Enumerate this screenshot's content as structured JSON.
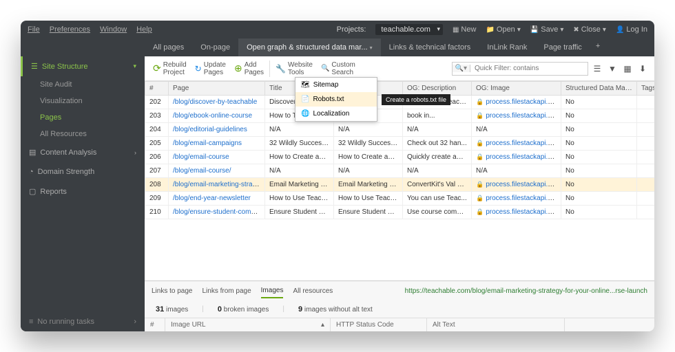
{
  "menubar": {
    "items": [
      "File",
      "Preferences",
      "Window",
      "Help"
    ],
    "projects_label": "Projects:",
    "project": "teachable.com",
    "actions": [
      "New",
      "Open",
      "Save",
      "Close",
      "Log In"
    ]
  },
  "tabs": [
    "All pages",
    "On-page",
    "Open graph & structured data mar...",
    "Links & technical factors",
    "InLink Rank",
    "Page traffic"
  ],
  "active_tab": 2,
  "sidebar": {
    "top": "Site Structure",
    "subs": [
      "Site Audit",
      "Visualization",
      "Pages",
      "All Resources"
    ],
    "active_sub": 2,
    "sections": [
      "Content Analysis",
      "Domain Strength",
      "Reports"
    ],
    "bottom": "No running tasks"
  },
  "toolbar": {
    "buttons": [
      {
        "icon": "↻",
        "label": "Rebuild\nProject"
      },
      {
        "icon": "↻",
        "label": "Update\nPages"
      },
      {
        "icon": "+",
        "label": "Add\nPages"
      },
      {
        "icon": "🔧",
        "label": "Website\nTools"
      },
      {
        "icon": "🔍",
        "label": "Custom\nSearch"
      }
    ],
    "filter_placeholder": "Quick Filter: contains"
  },
  "dropdown": {
    "items": [
      "Sitemap",
      "Robots.txt",
      "Localization"
    ],
    "hover": 1,
    "tooltip": "Create a robots.txt file"
  },
  "columns": [
    "#",
    "Page",
    "Title",
    "",
    "OG: Description",
    "OG: Image",
    "Structured Data Mark...",
    "Tags"
  ],
  "rows": [
    {
      "n": "202",
      "page": "/blog/discover-by-teachable",
      "title": "Discover by Tea...",
      "ogt": "",
      "ogd": "Discover by Teach...",
      "ogi": "process.filestackapi.co...",
      "sd": "No"
    },
    {
      "n": "203",
      "page": "/blog/ebook-online-course",
      "title": "How to Turn Your ...",
      "ogt": "How to Turn",
      "ogd": "book in...",
      "ogi": "process.filestackapi.co...",
      "sd": "No"
    },
    {
      "n": "204",
      "page": "/blog/editorial-guidelines",
      "title": "N/A",
      "ogt": "N/A",
      "ogd": "N/A",
      "ogi": "N/A",
      "sd": "No"
    },
    {
      "n": "205",
      "page": "/blog/email-campaigns",
      "title": "32 Wildly Success...",
      "ogt": "32 Wildly Success...",
      "ogd": "Check out 32 han...",
      "ogi": "process.filestackapi.co...",
      "sd": "No"
    },
    {
      "n": "206",
      "page": "/blog/email-course",
      "title": "How to Create an ...",
      "ogt": "How to Create an ...",
      "ogd": "Quickly create an ...",
      "ogi": "process.filestackapi.co...",
      "sd": "No"
    },
    {
      "n": "207",
      "page": "/blog/email-course/",
      "title": "N/A",
      "ogt": "N/A",
      "ogd": "N/A",
      "ogi": "N/A",
      "sd": "No"
    },
    {
      "n": "208",
      "page": "/blog/email-marketing-strateg",
      "title": "Email Marketing S...",
      "ogt": "Email Marketing S...",
      "ogd": "ConvertKit's Val G...",
      "ogi": "process.filestackapi.co...",
      "sd": "No",
      "sel": true
    },
    {
      "n": "209",
      "page": "/blog/end-year-newsletter",
      "title": "How to Use Teach...",
      "ogt": "How to Use Teach...",
      "ogd": "You can use Teac...",
      "ogi": "process.filestackapi.co...",
      "sd": "No"
    },
    {
      "n": "210",
      "page": "/blog/ensure-student-compre",
      "title": "Ensure Student C...",
      "ogt": "Ensure Student C...",
      "ogd": "Use course compl...",
      "ogi": "process.filestackapi.co...",
      "sd": "No"
    }
  ],
  "subtabs": {
    "tabs": [
      "Links to page",
      "Links from page",
      "Images",
      "All resources"
    ],
    "active": 2,
    "url": "https://teachable.com/blog/email-marketing-strategy-for-your-online...rse-launch",
    "stats": [
      {
        "n": "31",
        "label": "images"
      },
      {
        "n": "0",
        "label": "broken images"
      },
      {
        "n": "9",
        "label": "images without alt text"
      }
    ],
    "headers": [
      "#",
      "Image URL",
      "HTTP Status Code",
      "Alt Text"
    ]
  }
}
